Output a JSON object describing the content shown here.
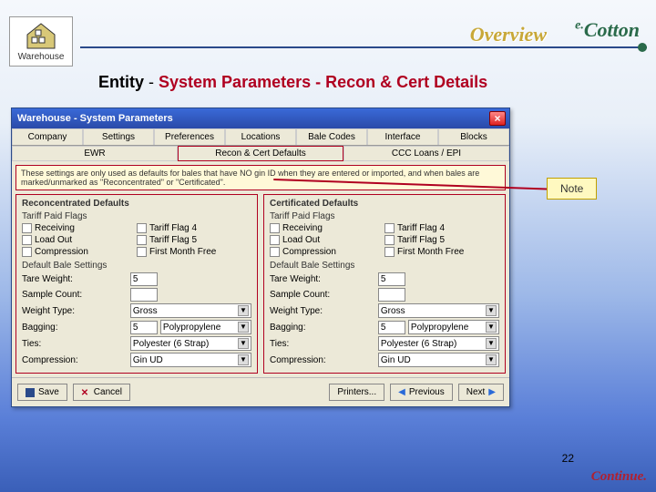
{
  "header": {
    "icon_label": "Warehouse",
    "overview": "Overview",
    "logo_prefix": "e.",
    "logo_main": "Cotton"
  },
  "breadcrumb": {
    "entity": "Entity",
    "sep1": " - ",
    "sys": "System Parameters",
    "sep2": " - ",
    "tail": "Recon & Cert Details"
  },
  "window": {
    "title": "Warehouse - System Parameters",
    "tabs_row1": [
      "Company",
      "Settings",
      "Preferences",
      "Locations",
      "Bale Codes",
      "Interface",
      "Blocks"
    ],
    "tabs_row2": [
      "EWR",
      "Recon & Cert Defaults",
      "CCC Loans / EPI"
    ],
    "active_tab_r2": 1,
    "note_text": "These settings are only used as defaults for bales that have NO gin ID when they are entered or imported, and when bales are marked/unmarked as \"Reconcentrated\" or \"Certificated\"."
  },
  "groups": [
    {
      "title": "Reconcentrated Defaults",
      "tariff_label": "Tariff Paid Flags",
      "flags": [
        "Receiving",
        "Tariff Flag 4",
        "Load Out",
        "Tariff Flag 5",
        "Compression",
        "First Month Free"
      ],
      "bale_label": "Default Bale Settings",
      "fields": {
        "tare_label": "Tare Weight:",
        "tare_val": "5",
        "sample_label": "Sample Count:",
        "sample_val": "",
        "weight_label": "Weight Type:",
        "weight_val": "Gross",
        "bagging_label": "Bagging:",
        "bagging_code": "5",
        "bagging_val": "Polypropylene",
        "ties_label": "Ties:",
        "ties_val": "Polyester (6 Strap)",
        "comp_label": "Compression:",
        "comp_val": "Gin UD"
      }
    },
    {
      "title": "Certificated Defaults",
      "tariff_label": "Tariff Paid Flags",
      "flags": [
        "Receiving",
        "Tariff Flag 4",
        "Load Out",
        "Tariff Flag 5",
        "Compression",
        "First Month Free"
      ],
      "bale_label": "Default Bale Settings",
      "fields": {
        "tare_label": "Tare Weight:",
        "tare_val": "5",
        "sample_label": "Sample Count:",
        "sample_val": "",
        "weight_label": "Weight Type:",
        "weight_val": "Gross",
        "bagging_label": "Bagging:",
        "bagging_code": "5",
        "bagging_val": "Polypropylene",
        "ties_label": "Ties:",
        "ties_val": "Polyester (6 Strap)",
        "comp_label": "Compression:",
        "comp_val": "Gin UD"
      }
    }
  ],
  "buttons": {
    "save": "Save",
    "cancel": "Cancel",
    "printers": "Printers...",
    "previous": "Previous",
    "next": "Next"
  },
  "callout": {
    "note": "Note"
  },
  "footer": {
    "page": "22",
    "continue": "Continue."
  }
}
